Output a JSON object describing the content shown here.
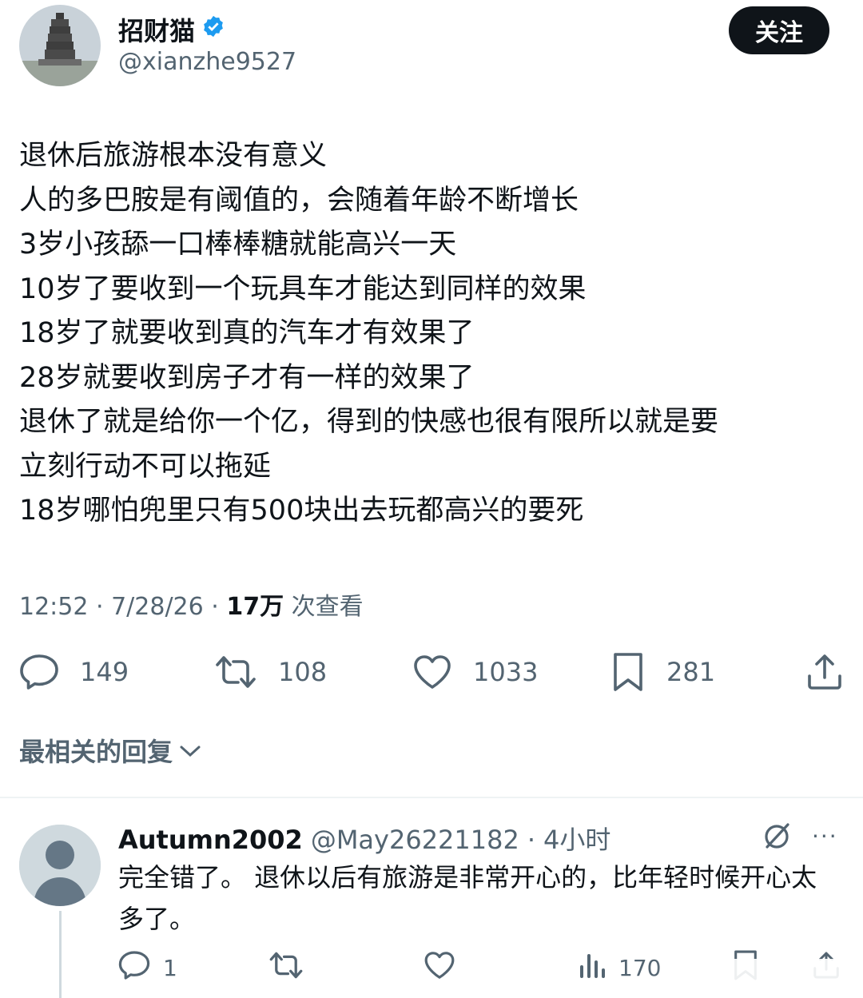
{
  "post": {
    "author_name": "招财猫",
    "author_handle": "@xianzhe9527",
    "follow_label": "关注",
    "lines": [
      "退休后旅游根本没有意义",
      "人的多巴胺是有阈值的，会随着年龄不断增长",
      "3岁小孩舔一口棒棒糖就能高兴一天",
      "10岁了要收到一个玩具车才能达到同样的效果",
      "18岁了就要收到真的汽车才有效果了",
      "28岁就要收到房子才有一样的效果了",
      "退休了就是给你一个亿，得到的快感也很有限所以就是要",
      "立刻行动不可以拖延",
      "18岁哪怕兜里只有500块出去玩都高兴的要死"
    ],
    "time": "12:52",
    "date": "7/28/26",
    "views_count": "17万",
    "views_label": "次查看",
    "replies": "149",
    "reposts": "108",
    "likes": "1033",
    "bookmarks": "281"
  },
  "replies_heading": "最相关的回复",
  "reply": {
    "name": "Autumn2002",
    "handle": "@May26221182",
    "time": "4小时",
    "text": "完全错了。 退休以后有旅游是非常开心的，比年轻时候开心太多了。",
    "replies": "1",
    "views": "170"
  },
  "icons": [
    "verified-badge-icon",
    "reply-icon",
    "repost-icon",
    "like-icon",
    "bookmark-icon",
    "share-icon",
    "chevron-down-icon",
    "grok-icon",
    "more-icon",
    "views-icon"
  ],
  "colors": {
    "verified": "#1d9bf0",
    "muted": "#536471",
    "text": "#0f1419",
    "button_bg": "#0f1419"
  }
}
